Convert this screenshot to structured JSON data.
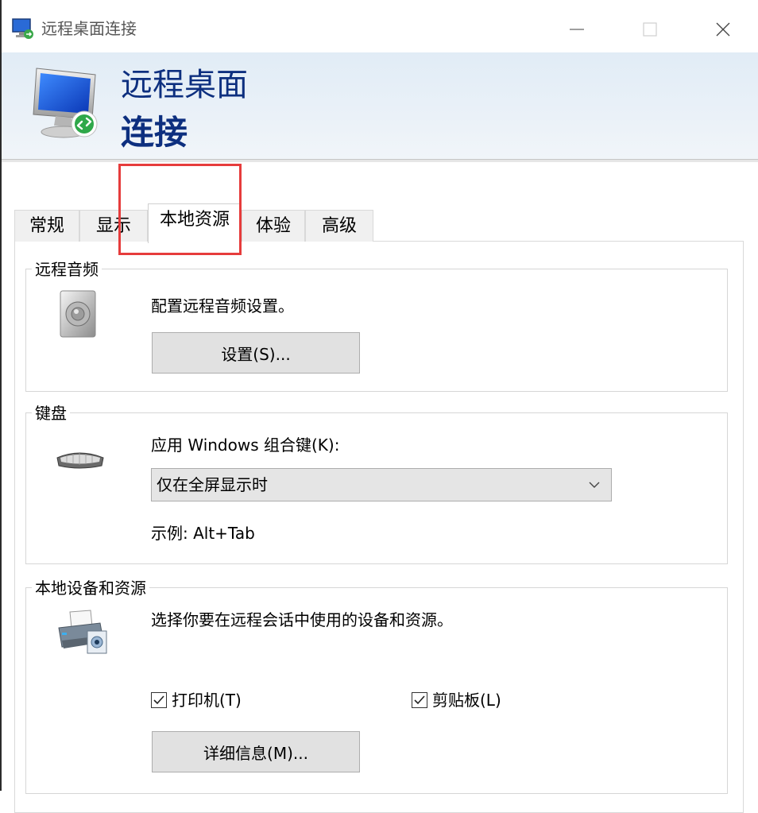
{
  "window": {
    "title": "远程桌面连接"
  },
  "banner": {
    "line1": "远程桌面",
    "line2": "连接"
  },
  "tabs": [
    {
      "label": "常规"
    },
    {
      "label": "显示"
    },
    {
      "label": "本地资源",
      "active": true
    },
    {
      "label": "体验"
    },
    {
      "label": "高级"
    }
  ],
  "remote_audio": {
    "legend": "远程音频",
    "description": "配置远程音频设置。",
    "settings_button": "设置(S)..."
  },
  "keyboard": {
    "legend": "键盘",
    "apply_label": "应用 Windows 组合键(K):",
    "selected_option": "仅在全屏显示时",
    "example": "示例: Alt+Tab"
  },
  "local_devices": {
    "legend": "本地设备和资源",
    "description": "选择你要在远程会话中使用的设备和资源。",
    "printer_label": "打印机(T)",
    "printer_checked": true,
    "clipboard_label": "剪贴板(L)",
    "clipboard_checked": true,
    "details_button": "详细信息(M)..."
  },
  "colors": {
    "banner_text": "#0d2f7f",
    "highlight": "#e63c3c"
  }
}
